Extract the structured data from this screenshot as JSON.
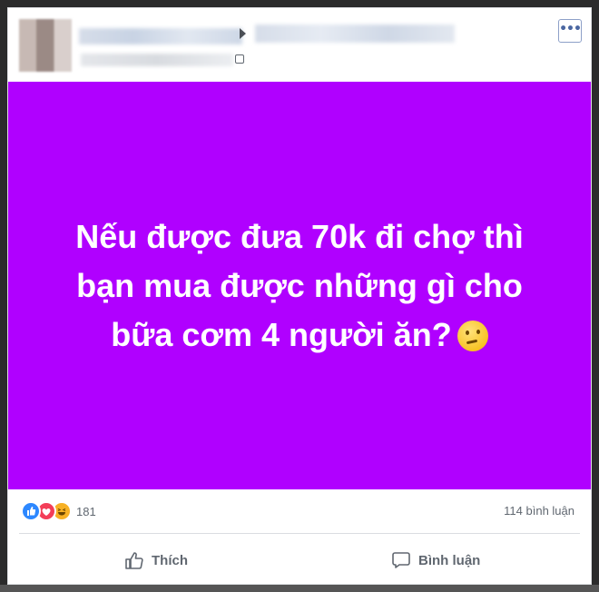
{
  "post": {
    "line1": "Nếu được đưa 70k đi chợ thì",
    "line2": "bạn mua được những gì cho",
    "line3": "bữa cơm 4 người ăn?",
    "background_color": "#b000ff",
    "emoji": "thinking-face"
  },
  "header": {
    "more_label": "•••"
  },
  "stats": {
    "reaction_count": "181",
    "comment_count": "114 bình luận",
    "reactions": [
      "like",
      "love",
      "haha"
    ]
  },
  "actions": {
    "like_label": "Thích",
    "comment_label": "Bình luận"
  }
}
